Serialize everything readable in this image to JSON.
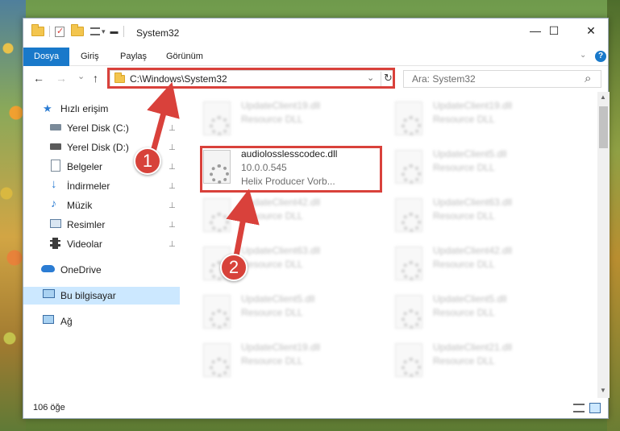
{
  "window": {
    "title": "System32",
    "minimize": "—",
    "maximize": "☐",
    "close": "✕"
  },
  "ribbon": {
    "tabs": [
      {
        "label": "Dosya",
        "active": true
      },
      {
        "label": "Giriş"
      },
      {
        "label": "Paylaş"
      },
      {
        "label": "Görünüm"
      }
    ],
    "expand_icon": "chevron-down-icon",
    "help_label": "?"
  },
  "nav": {
    "back": "←",
    "forward": "→",
    "recent": "⌄",
    "up": "↑",
    "address": "C:\\Windows\\System32",
    "refresh": "↻",
    "search_placeholder": "Ara: System32",
    "search_icon": "⌕"
  },
  "sidebar": {
    "items": [
      {
        "label": "Hızlı erişim",
        "icon": "star-icon"
      },
      {
        "label": "Yerel Disk (C:)",
        "icon": "drive-icon",
        "pinned": true
      },
      {
        "label": "Yerel Disk (D:)",
        "icon": "drive-icon",
        "pinned": true
      },
      {
        "label": "Belgeler",
        "icon": "documents-icon",
        "pinned": true
      },
      {
        "label": "İndirmeler",
        "icon": "download-icon",
        "pinned": true
      },
      {
        "label": "Müzik",
        "icon": "music-icon",
        "pinned": true
      },
      {
        "label": "Resimler",
        "icon": "pictures-icon",
        "pinned": true
      },
      {
        "label": "Videolar",
        "icon": "videos-icon",
        "pinned": true
      },
      {
        "label": "OneDrive",
        "icon": "cloud-icon"
      },
      {
        "label": "Bu bilgisayar",
        "icon": "computer-icon",
        "selected": true
      },
      {
        "label": "Ağ",
        "icon": "network-icon"
      }
    ],
    "pin_glyph": "📌"
  },
  "files": {
    "highlighted": {
      "name": "audiolosslesscodec.dll",
      "version": "10.0.0.545",
      "description": "Helix Producer Vorb..."
    },
    "left_column": [
      {
        "name": "UpdateClient19.dll",
        "type": "Resource DLL"
      },
      {
        "name": "UpdateClient42.dll",
        "type": "Resource DLL"
      },
      {
        "name": "UpdateClient63.dll",
        "type": "Resource DLL"
      },
      {
        "name": "UpdateClient5.dll",
        "type": "Resource DLL"
      },
      {
        "name": "UpdateClient19.dll",
        "type": "Resource DLL"
      }
    ],
    "right_column": [
      {
        "name": "UpdateClient19.dll",
        "type": "Resource DLL"
      },
      {
        "name": "UpdateClient5.dll",
        "type": "Resource DLL"
      },
      {
        "name": "UpdateClient63.dll",
        "type": "Resource DLL"
      },
      {
        "name": "UpdateClient42.dll",
        "type": "Resource DLL"
      },
      {
        "name": "UpdateClient5.dll",
        "type": "Resource DLL"
      },
      {
        "name": "UpdateClient21.dll",
        "type": "Resource DLL"
      }
    ]
  },
  "status": {
    "item_count": "106 öğe"
  },
  "annotations": {
    "badge_1": "1",
    "badge_2": "2",
    "color": "#d9413b"
  }
}
